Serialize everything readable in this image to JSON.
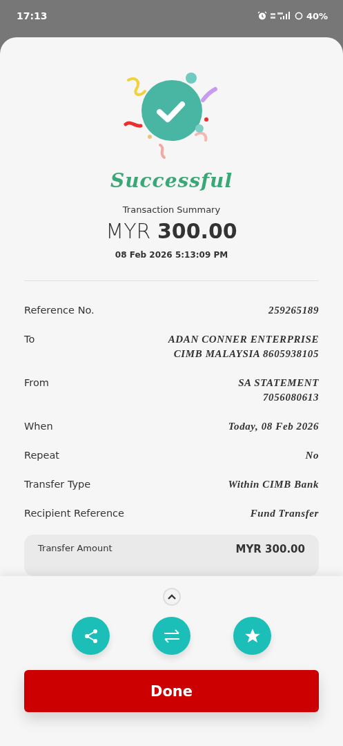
{
  "status_bar": {
    "time": "17:13",
    "battery": "40%"
  },
  "result": {
    "title": "Successful",
    "subtitle": "Transaction Summary",
    "currency": "MYR",
    "amount": "300.00",
    "datetime": "08 Feb 2026 5:13:09 PM"
  },
  "details": [
    {
      "label": "Reference No.",
      "lines": [
        "259265189"
      ]
    },
    {
      "label": "To",
      "lines": [
        "ADAN CONNER ENTERPRISE",
        "CIMB MALAYSIA 8605938105"
      ]
    },
    {
      "label": "From",
      "lines": [
        "SA STATEMENT",
        "7056080613"
      ]
    },
    {
      "label": "When",
      "lines": [
        "Today, 08 Feb 2026"
      ]
    },
    {
      "label": "Repeat",
      "lines": [
        "No"
      ]
    },
    {
      "label": "Transfer Type",
      "lines": [
        "Within CIMB Bank"
      ]
    },
    {
      "label": "Recipient Reference",
      "lines": [
        "Fund Transfer"
      ]
    }
  ],
  "summary_card": {
    "label": "Transfer Amount",
    "value": "MYR 300.00"
  },
  "actions": [
    {
      "kind": "share"
    },
    {
      "kind": "transfer"
    },
    {
      "kind": "favourite"
    }
  ],
  "done_button": "Done"
}
